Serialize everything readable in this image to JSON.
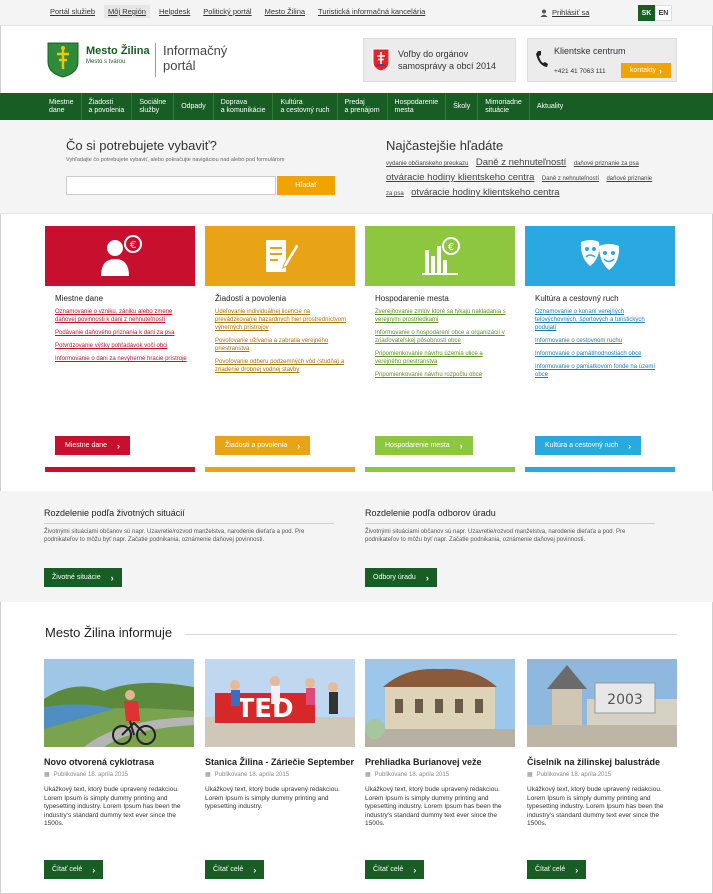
{
  "topbar": {
    "links": [
      "Portál služieb",
      "Môj Región",
      "Helpdesk",
      "Politický portál",
      "Mesto Žilina",
      "Turistická informačná kancelária"
    ],
    "login": "Prihlásiť sa",
    "lang_sk": "SK",
    "lang_en": "EN"
  },
  "header": {
    "brand_name": "Mesto Žilina",
    "brand_sub": "Mesto s tvárou",
    "portal_line1": "Informačný",
    "portal_line2": "portál",
    "election_line1": "Voľby do orgánov",
    "election_line2": "samosprávy a obcí 2014",
    "client_title": "Klientske centrum",
    "client_phone": "+421 41 7063 111",
    "contacts_btn": "kontakty"
  },
  "nav": [
    {
      "l1": "Miestne",
      "l2": "dane"
    },
    {
      "l1": "Žiadosti",
      "l2": "a povolenia"
    },
    {
      "l1": "Sociálne",
      "l2": "služby"
    },
    {
      "l1": "Odpady",
      "l2": ""
    },
    {
      "l1": "Doprava",
      "l2": "a komunikácie"
    },
    {
      "l1": "Kultúra",
      "l2": "a cestovný ruch"
    },
    {
      "l1": "Predaj",
      "l2": "a prenájom"
    },
    {
      "l1": "Hospodarenie",
      "l2": "mesta"
    },
    {
      "l1": "Školy",
      "l2": ""
    },
    {
      "l1": "Mimoriadne",
      "l2": "situácie"
    },
    {
      "l1": "Aktuality",
      "l2": ""
    }
  ],
  "search": {
    "title": "Čo si potrebujete vybaviť?",
    "subtitle": "Vyhľadajte čo potrebujete vybaviť, alebo pokračujte navigáciou nad alebo pod formulárom",
    "input_value": "",
    "button": "Hľadať"
  },
  "frequent": {
    "title": "Najčastejšie hľadáte",
    "links": [
      "vydanie občianskeho preukazu",
      "Daně z nehnuteľností",
      "daňové priznanie za psa",
      "otváracie hodiny klientskeho centra",
      "Daně z nehnuteľností",
      "daňové priznanie za psa",
      "otváracie hodiny klientskeho centra"
    ]
  },
  "cards": [
    {
      "title": "Miestne dane",
      "links": [
        "Oznamovanie o vzniku, zániku alebo zmene daňovej povinnosti k dani z nehnuteľností",
        "Podávanie daňového priznania k dani za psa",
        "Potvrdzovanie výšky pohľadávok voči obci",
        "Informovanie o dani za nevýherné hracie prístroje"
      ],
      "button": "Miestne dane",
      "color": "#c8102e"
    },
    {
      "title": "Žiadosti a povolenia",
      "links": [
        "Udeľovanie individuálnej licencie na prevádzkovanie hazardných hier prostredníctvom výherných prístrojov",
        "Povoľovanie užívania a zabratia verejného priestranstva",
        "Povoľovanie odberu podzemných vôd (studňa) a zriadenie drobnej vodnej stavby"
      ],
      "button": "Žiadosti a povolenia",
      "color": "#e8a317"
    },
    {
      "title": "Hospodarenie mesta",
      "links": [
        "Zverejňovanie zmlúv ktoré sa týkajú nakladania s verejnými prostriedkami",
        "Informovanie o hospodárení obce a organizácií v zriaďovateľskej pôsobnosti obce",
        "Pripomienkovanie návrhu územia ulice a verejného priestranstva",
        "Pripomienkovanie návrhu rozpočtu obce"
      ],
      "button": "Hospodarenie mesta",
      "color": "#8dc63f"
    },
    {
      "title": "Kultúra a cestovný ruch",
      "links": [
        "Oznamovanie o konaní verejných telovýchovných, športových a turistických podujatí",
        "Informovanie o cestovnom ruchu",
        "Informovanie o pamätihodnostiach obce",
        "Informovanie o pamiatkovom fonde na území obce"
      ],
      "button": "Kultúra a cestovný ruch",
      "color": "#2aa8e0"
    }
  ],
  "life": {
    "left_title": "Rozdelenie podľa životných situácií",
    "left_text": "Životnými situáciami občanov sú napr. Uzavretie/rozvod manželstva, narodenie dieťaťa a pod. Pre podnikateľov to môžu byť napr. Začatie podnikania, oznámenie daňovej povinnosti.",
    "left_btn": "Životné situácie",
    "right_title": "Rozdelenie podľa odborov úradu",
    "right_text": "Životnými situáciami občanov sú napr. Uzavretie/rozvod manželstva, narodenie dieťaťa a pod. Pre podnikateľov to môžu byť napr. Začatie podnikania, oznámenie daňovej povinnosti.",
    "right_btn": "Odbory úradu"
  },
  "news": {
    "heading": "Mesto Žilina informuje",
    "items": [
      {
        "title": "Novo otvorená cyklotrasa",
        "date": "Publikované 18. apríla 2015",
        "text": "Ukážkový text, ktorý bude upravený redakciou. Lorem Ipsum is simply dummy printing and typesetting industry. Lorem Ipsum has been the industry's standard dummy text ever since the 1500s.",
        "btn": "Čítať celé"
      },
      {
        "title": "Stanica Žilina - Záriečie September",
        "date": "Publikované 18. apríla 2015",
        "text": "Ukážkový text, ktorý bude upravený redakciou. Lorem Ipsum is simply dummy printing and typesetting industry.",
        "btn": "Čítať celé"
      },
      {
        "title": "Prehliadka Burianovej veže",
        "date": "Publikované 18. apríla 2015",
        "text": "Ukážkový text, ktorý bude upravený redakciou. Lorem Ipsum is simply dummy printing and typesetting industry. Lorem Ipsum has been the industry's standard dummy text ever since the 1500s.",
        "btn": "Čítať celé"
      },
      {
        "title": "Čiselník na žilinskej balustráde",
        "date": "Publikované 18. apríla 2015",
        "text": "Ukážkový text, ktorý bude upravený redakciou. Lorem Ipsum is simply dummy printing and typesetting industry. Lorem Ipsum has been the industry's standard dummy text ever since the 1500s.",
        "btn": "Čítať celé"
      }
    ]
  },
  "colors": {
    "green": "#175d24",
    "orange": "#f1a300",
    "red": "#c8102e",
    "yellow": "#e8a317",
    "lime": "#8dc63f",
    "blue": "#2aa8e0"
  },
  "illustration_texts": {
    "ted_sign": "TED",
    "clock_number": "2003"
  }
}
